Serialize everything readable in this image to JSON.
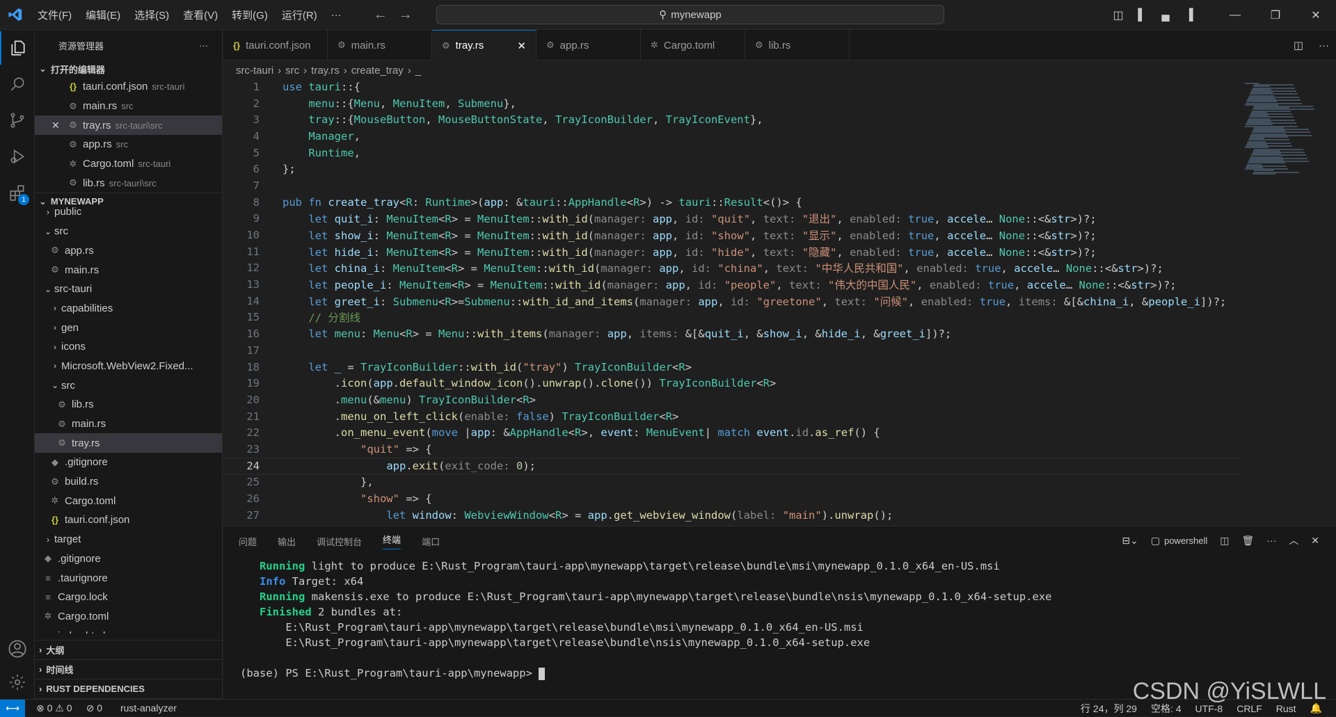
{
  "titlebar": {
    "menu": [
      "文件(F)",
      "编辑(E)",
      "选择(S)",
      "查看(V)",
      "转到(G)",
      "运行(R)",
      "···"
    ],
    "search": "mynewapp"
  },
  "sidebar": {
    "title": "资源管理器",
    "open_editors_label": "打开的编辑器",
    "open_editors": [
      {
        "name": "tauri.conf.json",
        "desc": "src-tauri",
        "icon": "json-icon"
      },
      {
        "name": "main.rs",
        "desc": "src",
        "icon": "rust-icon"
      },
      {
        "name": "tray.rs",
        "desc": "src-tauri\\src",
        "icon": "rust-icon"
      },
      {
        "name": "app.rs",
        "desc": "src",
        "icon": "rust-icon"
      },
      {
        "name": "Cargo.toml",
        "desc": "src-tauri",
        "icon": "gear-icon"
      },
      {
        "name": "lib.rs",
        "desc": "src-tauri\\src",
        "icon": "rust-icon"
      }
    ],
    "project_label": "MYNEWAPP",
    "tree": [
      {
        "name": "public",
        "indent": 1,
        "chev": "›"
      },
      {
        "name": "src",
        "indent": 1,
        "chev": "⌄"
      },
      {
        "name": "app.rs",
        "indent": 2,
        "icon": "rust-icon"
      },
      {
        "name": "main.rs",
        "indent": 2,
        "icon": "rust-icon"
      },
      {
        "name": "src-tauri",
        "indent": 1,
        "chev": "⌄"
      },
      {
        "name": "capabilities",
        "indent": 2,
        "chev": "›"
      },
      {
        "name": "gen",
        "indent": 2,
        "chev": "›"
      },
      {
        "name": "icons",
        "indent": 2,
        "chev": "›"
      },
      {
        "name": "Microsoft.WebView2.Fixed...",
        "indent": 2,
        "chev": "›"
      },
      {
        "name": "src",
        "indent": 2,
        "chev": "⌄"
      },
      {
        "name": "lib.rs",
        "indent": 3,
        "icon": "rust-icon"
      },
      {
        "name": "main.rs",
        "indent": 3,
        "icon": "rust-icon"
      },
      {
        "name": "tray.rs",
        "indent": 3,
        "icon": "rust-icon"
      },
      {
        "name": ".gitignore",
        "indent": 2,
        "icon": "git-icon"
      },
      {
        "name": "build.rs",
        "indent": 2,
        "icon": "rust-icon"
      },
      {
        "name": "Cargo.toml",
        "indent": 2,
        "icon": "gear-icon"
      },
      {
        "name": "tauri.conf.json",
        "indent": 2,
        "icon": "json-icon"
      },
      {
        "name": "target",
        "indent": 1,
        "chev": "›"
      },
      {
        "name": ".gitignore",
        "indent": 1,
        "icon": "git-icon"
      },
      {
        "name": ".taurignore",
        "indent": 1,
        "icon": "lines-icon"
      },
      {
        "name": "Cargo.lock",
        "indent": 1,
        "icon": "lines-icon"
      },
      {
        "name": "Cargo.toml",
        "indent": 1,
        "icon": "gear-icon"
      },
      {
        "name": "index.html",
        "indent": 1,
        "icon": "html-icon"
      }
    ],
    "bottom_sections": [
      "大纲",
      "时间线",
      "RUST DEPENDENCIES"
    ]
  },
  "tabs": [
    {
      "label": "tauri.conf.json",
      "icon": "json-icon"
    },
    {
      "label": "main.rs",
      "icon": "rust-icon"
    },
    {
      "label": "tray.rs",
      "icon": "rust-icon",
      "active": true
    },
    {
      "label": "app.rs",
      "icon": "rust-icon"
    },
    {
      "label": "Cargo.toml",
      "icon": "gear-icon"
    },
    {
      "label": "lib.rs",
      "icon": "rust-icon"
    }
  ],
  "breadcrumb": [
    "src-tauri",
    "src",
    "tray.rs",
    "create_tray",
    "_"
  ],
  "code_lines": [
    "use tauri::{",
    "    menu::{Menu, MenuItem, Submenu},",
    "    tray::{MouseButton, MouseButtonState, TrayIconBuilder, TrayIconEvent},",
    "    Manager,",
    "    Runtime,",
    "};",
    "",
    "pub fn create_tray<R: Runtime>(app: &tauri::AppHandle<R>) -> tauri::Result<()> {",
    "    let quit_i: MenuItem<R> = MenuItem::with_id(manager: app, id: \"quit\", text: \"退出\", enabled: true, accele… None::<&str>)?;",
    "    let show_i: MenuItem<R> = MenuItem::with_id(manager: app, id: \"show\", text: \"显示\", enabled: true, accele… None::<&str>)?;",
    "    let hide_i: MenuItem<R> = MenuItem::with_id(manager: app, id: \"hide\", text: \"隐藏\", enabled: true, accele… None::<&str>)?;",
    "    let china_i: MenuItem<R> = MenuItem::with_id(manager: app, id: \"china\", text: \"中华人民共和国\", enabled: true, accele… None::<&str>)?;",
    "    let people_i: MenuItem<R> = MenuItem::with_id(manager: app, id: \"people\", text: \"伟大的中国人民\", enabled: true, accele… None::<&str>)?;",
    "    let greet_i: Submenu<R>=Submenu::with_id_and_items(manager: app, id: \"greetone\", text: \"问候\", enabled: true, items: &[&china_i, &people_i])?;",
    "    // 分割线",
    "    let menu: Menu<R> = Menu::with_items(manager: app, items: &[&quit_i, &show_i, &hide_i, &greet_i])?;",
    "",
    "    let _ = TrayIconBuilder::with_id(\"tray\") TrayIconBuilder<R>",
    "        .icon(app.default_window_icon().unwrap().clone()) TrayIconBuilder<R>",
    "        .menu(&menu) TrayIconBuilder<R>",
    "        .menu_on_left_click(enable: false) TrayIconBuilder<R>",
    "        .on_menu_event(move |app: &AppHandle<R>, event: MenuEvent| match event.id.as_ref() {",
    "            \"quit\" => {",
    "                app.exit(exit_code: 0);",
    "            },",
    "            \"show\" => {",
    "                let window: WebviewWindow<R> = app.get_webview_window(label: \"main\").unwrap();"
  ],
  "current_line": 24,
  "panel": {
    "tabs": [
      "问题",
      "输出",
      "调试控制台",
      "终端",
      "端口"
    ],
    "active_tab": "终端",
    "shell": "powershell",
    "lines": [
      {
        "tag": "Running",
        "tagClass": "g",
        "text": " light to produce E:\\Rust_Program\\tauri-app\\mynewapp\\target\\release\\bundle\\msi\\mynewapp_0.1.0_x64_en-US.msi"
      },
      {
        "tag": "Info",
        "tagClass": "b",
        "text": " Target: x64"
      },
      {
        "tag": "Running",
        "tagClass": "g",
        "text": " makensis.exe to produce E:\\Rust_Program\\tauri-app\\mynewapp\\target\\release\\bundle\\nsis\\mynewapp_0.1.0_x64-setup.exe"
      },
      {
        "tag": "Finished",
        "tagClass": "g",
        "text": " 2 bundles at:"
      },
      {
        "tag": "",
        "tagClass": "",
        "text": "    E:\\Rust_Program\\tauri-app\\mynewapp\\target\\release\\bundle\\msi\\mynewapp_0.1.0_x64_en-US.msi"
      },
      {
        "tag": "",
        "tagClass": "",
        "text": "    E:\\Rust_Program\\tauri-app\\mynewapp\\target\\release\\bundle\\nsis\\mynewapp_0.1.0_x64-setup.exe"
      },
      {
        "tag": "",
        "tagClass": "",
        "text": ""
      },
      {
        "tag": "",
        "tagClass": "",
        "text": "(base) PS E:\\Rust_Program\\tauri-app\\mynewapp> "
      }
    ]
  },
  "statusbar": {
    "errors": "0",
    "warnings": "0",
    "ports": "0",
    "analyzer": "rust-analyzer",
    "position": "行 24，列 29",
    "spaces": "空格: 4",
    "encoding": "UTF-8",
    "eol": "CRLF",
    "language": "Rust"
  },
  "watermark": "CSDN @YiSLWLL"
}
